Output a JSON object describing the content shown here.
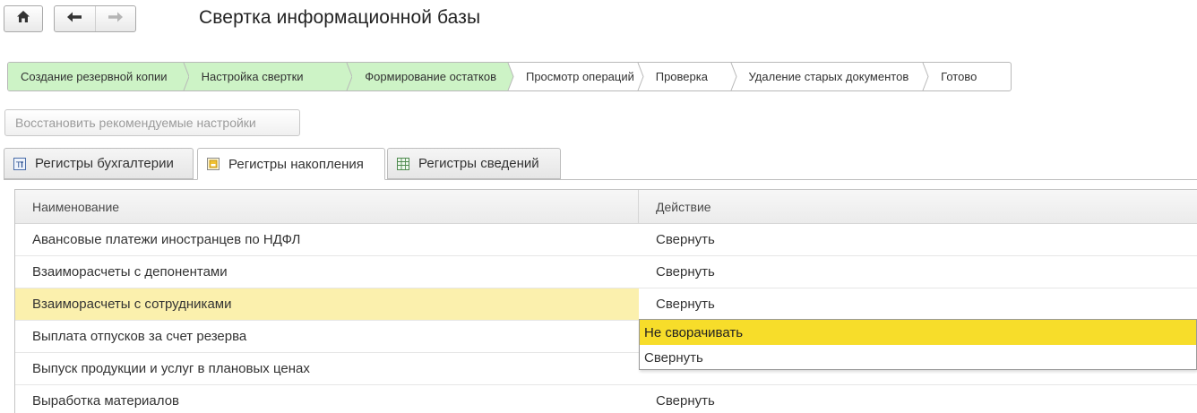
{
  "window": {
    "title": "Свертка информационной базы"
  },
  "toolbar": {
    "home_icon": "home-icon",
    "back_icon": "arrow-left-icon",
    "forward_icon": "arrow-right-icon"
  },
  "wizard": {
    "steps": [
      {
        "label": "Создание резервной копии",
        "done": true
      },
      {
        "label": "Настройка свертки",
        "done": true
      },
      {
        "label": "Формирование остатков",
        "done": true
      },
      {
        "label": "Просмотр операций",
        "done": false
      },
      {
        "label": "Проверка",
        "done": false
      },
      {
        "label": "Удаление старых документов",
        "done": false
      },
      {
        "label": "Готово",
        "done": false
      }
    ],
    "done_color": "#cdf3c6"
  },
  "restore_button": {
    "label": "Восстановить рекомендуемые настройки"
  },
  "tabs": [
    {
      "label": "Регистры бухгалтерии",
      "icon": "accounting-register-icon",
      "active": false
    },
    {
      "label": "Регистры накопления",
      "icon": "accumulation-register-icon",
      "active": true
    },
    {
      "label": "Регистры сведений",
      "icon": "information-register-icon",
      "active": false
    }
  ],
  "table": {
    "columns": [
      "Наименование",
      "Действие"
    ],
    "rows": [
      {
        "name": "Авансовые платежи иностранцев по НДФЛ",
        "action": "Свернуть"
      },
      {
        "name": "Взаиморасчеты с депонентами",
        "action": "Свернуть"
      },
      {
        "name": "Взаиморасчеты с сотрудниками",
        "action": "Свернуть",
        "selected": true
      },
      {
        "name": "Выплата отпусков за счет резерва",
        "action": ""
      },
      {
        "name": "Выпуск продукции и услуг в плановых ценах",
        "action": ""
      },
      {
        "name": "Выработка материалов",
        "action": "Свернуть"
      }
    ]
  },
  "dropdown": {
    "options": [
      "Не сворачивать",
      "Свернуть"
    ],
    "highlighted": "Не сворачивать",
    "highlight_color": "#f7dd2a"
  },
  "colors": {
    "selected_row": "#fbf0ad"
  }
}
